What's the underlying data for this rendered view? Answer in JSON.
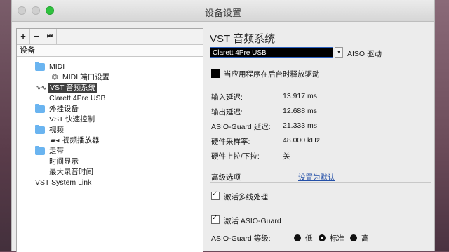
{
  "window": {
    "title": "设备设置"
  },
  "left": {
    "toolbar": {
      "add": "+",
      "remove": "−",
      "reset": "⏮"
    },
    "header": "设备",
    "items": [
      {
        "label": "MIDI"
      },
      {
        "label": "MIDI 端口设置"
      },
      {
        "label": "VST 音频系统"
      },
      {
        "label": "Clarett 4Pre USB"
      },
      {
        "label": "外挂设备"
      },
      {
        "label": "VST 快速控制"
      },
      {
        "label": "视频"
      },
      {
        "label": "视频播放器"
      },
      {
        "label": "走带"
      },
      {
        "label": "时间显示"
      },
      {
        "label": "最大录音时间"
      },
      {
        "label": "VST System Link"
      }
    ]
  },
  "right": {
    "title": "VST 音频系统",
    "driver": {
      "selected": "Clarett 4Pre USB",
      "aiso_label": "AISO 驱动"
    },
    "release_driver_label": "当应用程序在后台时释放驱动",
    "stats": [
      {
        "label": "输入延迟:",
        "value": "13.917 ms"
      },
      {
        "label": "输出延迟:",
        "value": "12.688 ms"
      },
      {
        "label": "ASIO-Guard 延迟:",
        "value": "21.333 ms"
      },
      {
        "label": "硬件采样率:",
        "value": "48.000 kHz"
      },
      {
        "label": "硬件上拉/下拉:",
        "value": "关"
      }
    ],
    "advanced": {
      "label": "高级选项",
      "defaults_link": "设置为默认"
    },
    "multiprocessing_label": "激活多线处理",
    "asio_guard_label": "激活 ASIO-Guard",
    "asio_guard_level": {
      "label": "ASIO-Guard 等级:",
      "options": [
        "低",
        "标准",
        "高"
      ],
      "selected": "标准"
    }
  }
}
